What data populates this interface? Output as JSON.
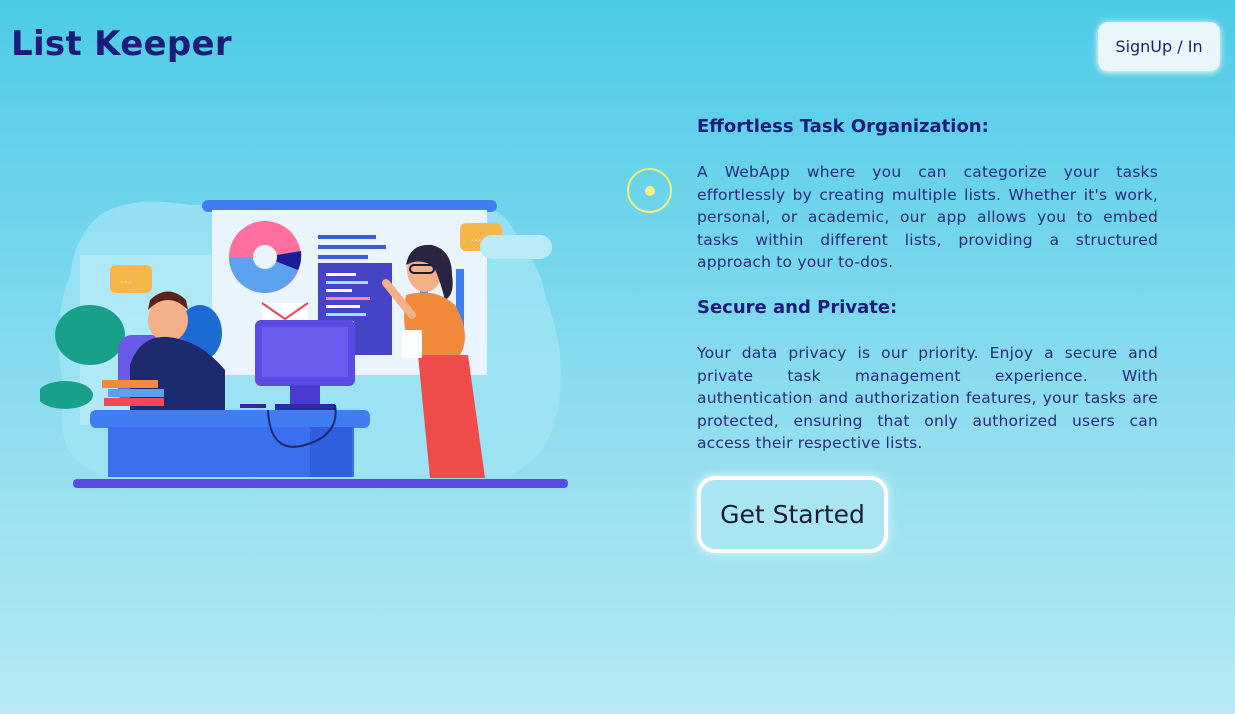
{
  "header": {
    "title": "List Keeper",
    "signup_label": "SignUp / In"
  },
  "features": [
    {
      "heading": "Effortless Task Organization:",
      "body": "A WebApp where you can categorize your tasks effortlessly by creating multiple lists. Whether it's work, personal, or academic, our app allows you to embed tasks within different lists, providing a structured approach to your to-dos."
    },
    {
      "heading": "Secure and Private:",
      "body": "Your data privacy is our priority. Enjoy a secure and private task management experience. With authentication and authorization features, your tasks are protected, ensuring that only authorized users can access their respective lists."
    }
  ],
  "cta": {
    "label": "Get Started"
  },
  "colors": {
    "brand": "#1c1c7a",
    "background_top": "#4ccbe6",
    "background_bottom": "#b6e9f4",
    "accent_yellow": "#f0f07a"
  },
  "illustration": {
    "icon": "office-team-illustration"
  }
}
